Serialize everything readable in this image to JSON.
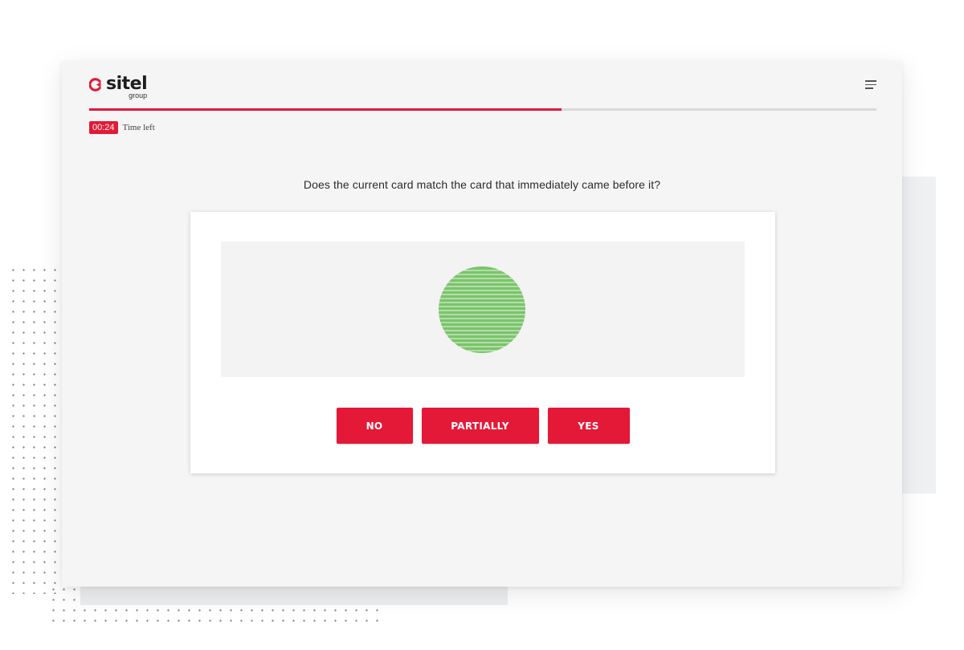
{
  "brand": {
    "name": "sitel",
    "subtitle": "group",
    "logo_icon": "sitel-logo-mark",
    "accent_color": "#e31937"
  },
  "header": {
    "menu_icon": "hamburger-menu-icon"
  },
  "progress": {
    "fraction": 0.6
  },
  "timer": {
    "value": "00:24",
    "label": "Time left"
  },
  "question": {
    "text": "Does the current card match the card that immediately came before it?"
  },
  "card": {
    "shape": "circle",
    "fill": "striped",
    "color": "#7ac46a"
  },
  "answers": {
    "no": "NO",
    "partially": "PARTIALLY",
    "yes": "YES"
  }
}
